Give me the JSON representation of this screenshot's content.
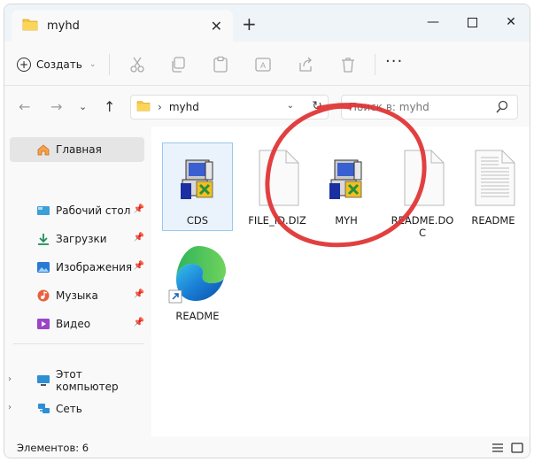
{
  "window": {
    "tab_title": "myhd",
    "new_tab_symbol": "+",
    "controls": [
      "minimize",
      "maximize",
      "close"
    ]
  },
  "toolbar": {
    "create_label": "Создать",
    "icons": [
      "cut-icon",
      "copy-icon",
      "paste-icon",
      "rename-icon",
      "share-icon",
      "delete-icon"
    ],
    "more_label": "···"
  },
  "address": {
    "path": "myhd",
    "search_placeholder": "Поиск в: myhd"
  },
  "sidebar": {
    "items": [
      {
        "label": "Главная",
        "icon": "home-icon",
        "selected": true
      },
      {
        "label": "Рабочий стол",
        "icon": "desktop-icon",
        "pinned": true
      },
      {
        "label": "Загрузки",
        "icon": "downloads-icon",
        "pinned": true
      },
      {
        "label": "Изображения",
        "icon": "pictures-icon",
        "pinned": true
      },
      {
        "label": "Музыка",
        "icon": "music-icon",
        "pinned": true
      },
      {
        "label": "Видео",
        "icon": "videos-icon",
        "pinned": true
      },
      {
        "label": "Этот компьютер",
        "icon": "computer-icon",
        "expandable": true
      },
      {
        "label": "Сеть",
        "icon": "network-icon",
        "expandable": true
      }
    ]
  },
  "files": [
    {
      "name": "CDS",
      "type": "installer",
      "selected": true
    },
    {
      "name": "FILE_ID.DIZ",
      "type": "blank-document"
    },
    {
      "name": "MYH",
      "type": "installer"
    },
    {
      "name": "README.DOC",
      "type": "blank-document"
    },
    {
      "name": "README",
      "type": "text-document"
    },
    {
      "name": "README",
      "type": "edge-shortcut"
    }
  ],
  "status": {
    "items_count": "Элементов: 6"
  },
  "colors": {
    "titlebar_bg": "#eff4f9",
    "selection": "#e5e5e5",
    "accent_folder": "#f8c73a",
    "annotation": "#e03030"
  }
}
